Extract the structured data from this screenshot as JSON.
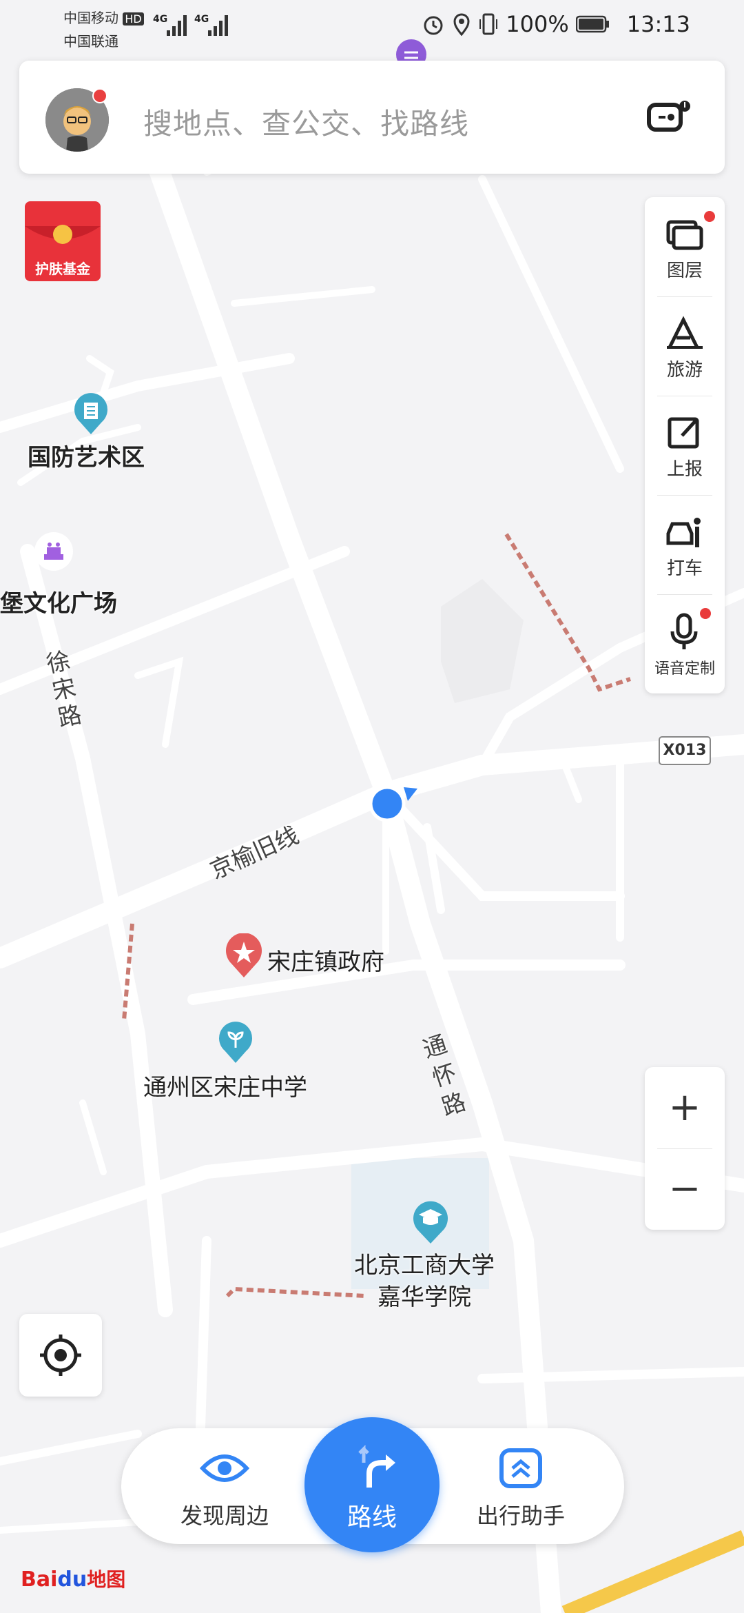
{
  "status_bar": {
    "carrier1": "中国移动",
    "carrier1_badge": "HD",
    "carrier2": "中国联通",
    "net1": "4G",
    "net2": "4G",
    "battery": "100%",
    "time": "13:13"
  },
  "search": {
    "placeholder": "搜地点、查公交、找路线"
  },
  "promo": {
    "label": "护肤基金"
  },
  "side_panel": {
    "items": [
      {
        "label": "图层",
        "icon": "layers-icon"
      },
      {
        "label": "旅游",
        "icon": "travel-icon"
      },
      {
        "label": "上报",
        "icon": "report-icon"
      },
      {
        "label": "打车",
        "icon": "taxi-icon"
      },
      {
        "label": "语音定制",
        "icon": "microphone-icon"
      }
    ]
  },
  "zoom": {
    "in": "+",
    "out": "−"
  },
  "map": {
    "pois": [
      {
        "name": "国防艺术区"
      },
      {
        "name": "堡文化广场"
      },
      {
        "name": "宋庄镇政府"
      },
      {
        "name": "通州区宋庄中学"
      },
      {
        "name": "北京工商大学"
      },
      {
        "name": "嘉华学院"
      }
    ],
    "roads": {
      "xusong": "徐宋路",
      "jingyu": "京榆旧线",
      "tonghuai": "通怀路"
    },
    "road_tag": "X013"
  },
  "bottom_nav": {
    "discover": "发现周边",
    "route": "路线",
    "assistant": "出行助手"
  },
  "brand": {
    "logo_b": "Bai",
    "logo_du": "du",
    "logo_map": "地图"
  },
  "colors": {
    "accent": "#3385f5",
    "map_bg": "#f3f3f5",
    "road": "#ffffff",
    "alert": "#e93b3b",
    "poi_teal": "#3fa9c9"
  }
}
